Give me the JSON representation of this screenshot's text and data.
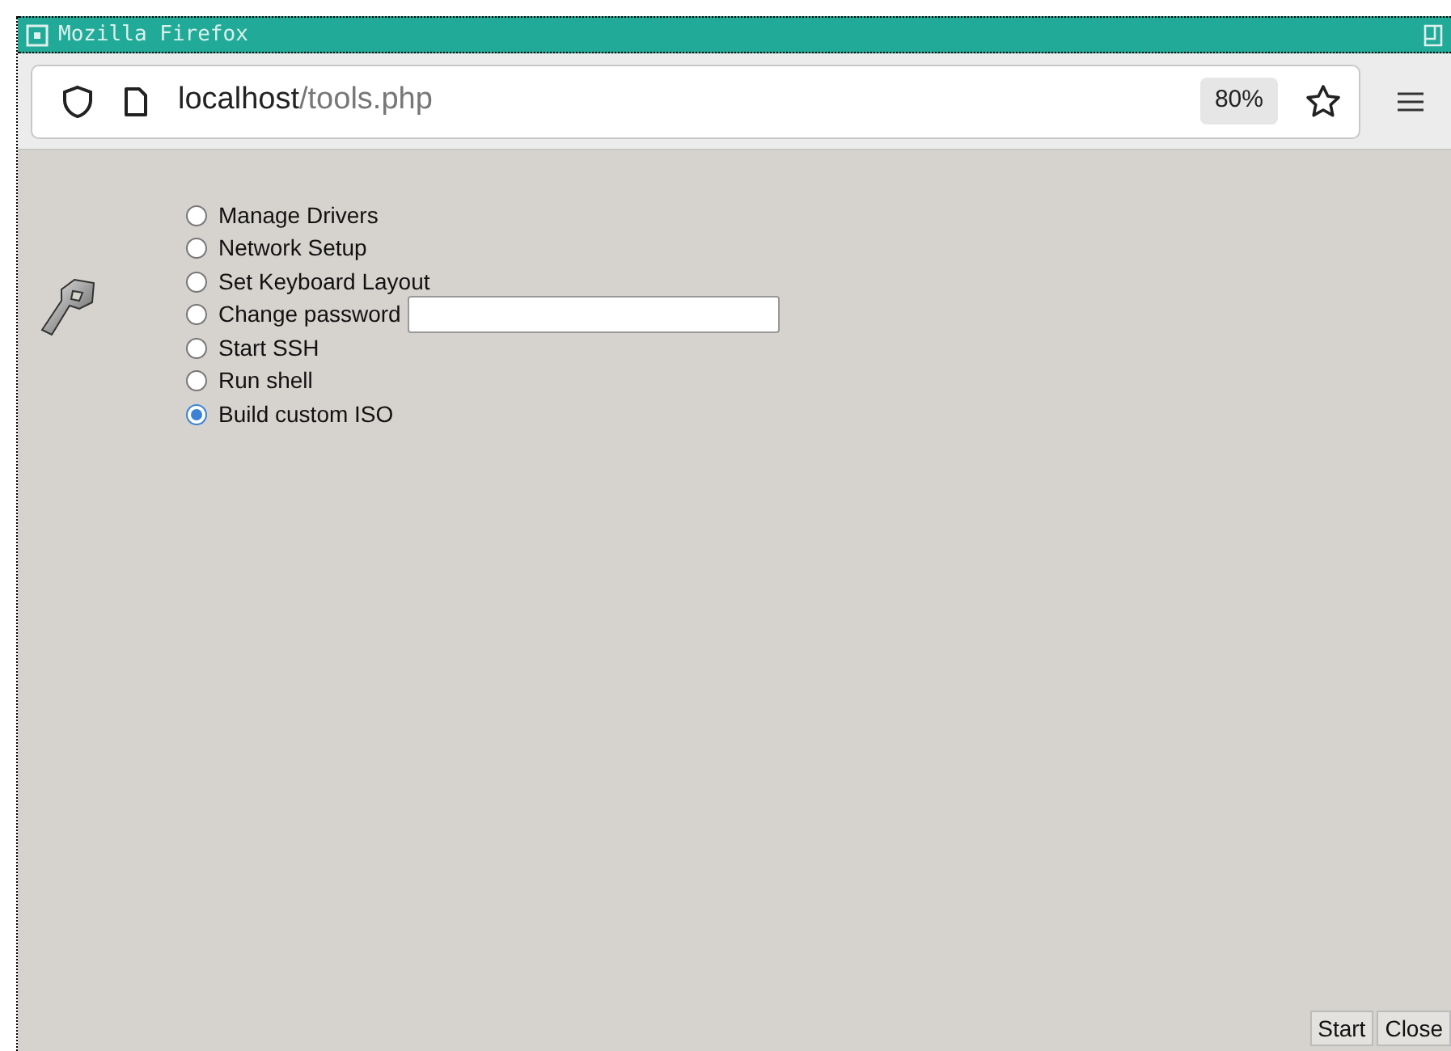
{
  "window": {
    "title": "Mozilla Firefox"
  },
  "address_bar": {
    "host": "localhost",
    "path": "/tools.php",
    "zoom": "80%"
  },
  "options": [
    {
      "label": "Manage Drivers",
      "kind": "radio",
      "selected": false
    },
    {
      "label": "Network Setup",
      "kind": "radio",
      "selected": false
    },
    {
      "label": "Set Keyboard Layout",
      "kind": "radio",
      "selected": false
    },
    {
      "label": "Change password",
      "kind": "radio_field",
      "selected": false
    },
    {
      "label": "Start SSH",
      "kind": "radio",
      "selected": false
    },
    {
      "label": "Run shell",
      "kind": "radio",
      "selected": false
    },
    {
      "label": "Build custom ISO",
      "kind": "radio",
      "selected": true
    }
  ],
  "buttons": [
    "Start",
    "Close"
  ]
}
